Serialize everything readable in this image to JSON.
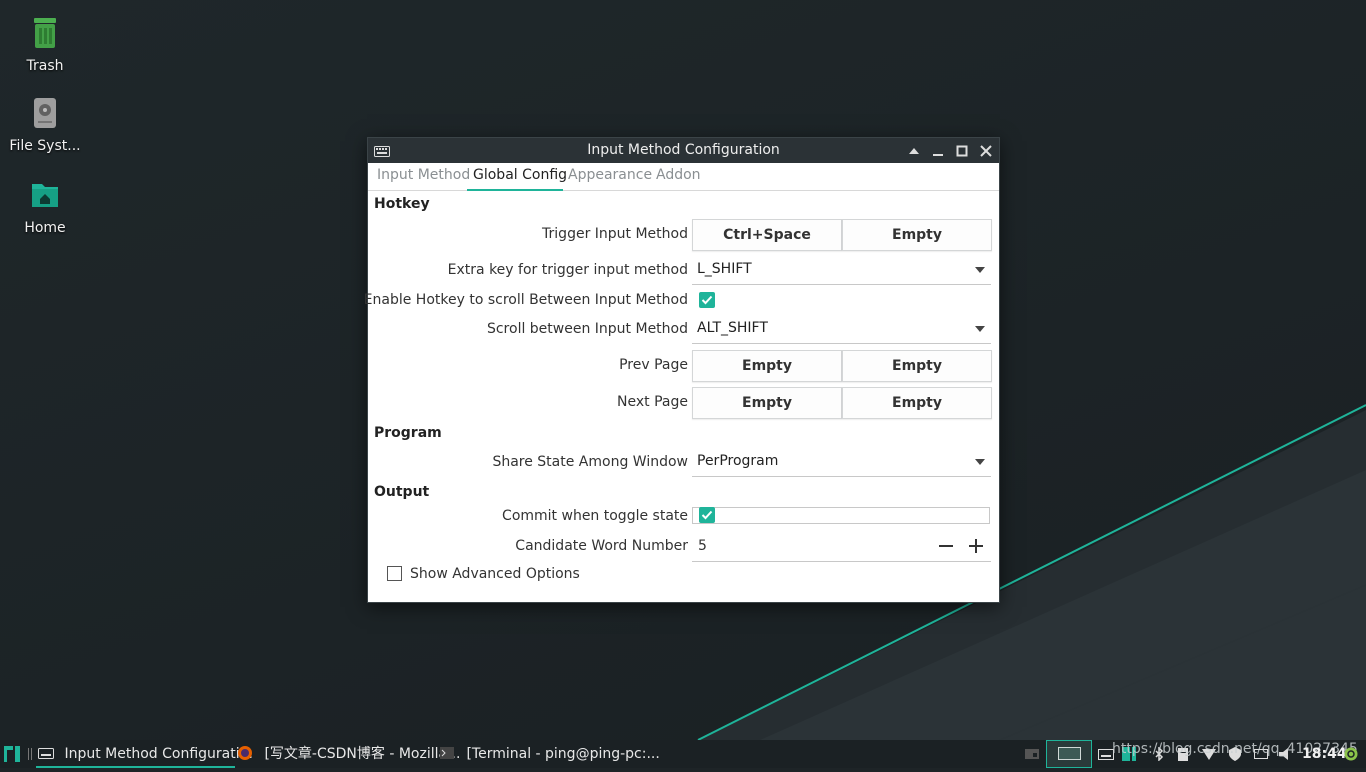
{
  "desktop": {
    "icons": [
      {
        "label": "Trash"
      },
      {
        "label": "File Syst..."
      },
      {
        "label": "Home"
      }
    ]
  },
  "window": {
    "title": "Input Method Configuration",
    "tabs": [
      {
        "label": "Input Method"
      },
      {
        "label": "Global Config"
      },
      {
        "label": "Appearance"
      },
      {
        "label": "Addon"
      }
    ],
    "active_tab": "Global Config",
    "sections": {
      "hotkey": "Hotkey",
      "program": "Program",
      "output": "Output"
    },
    "rows": {
      "trigger": {
        "label": "Trigger Input Method",
        "key1": "Ctrl+Space",
        "key2": "Empty"
      },
      "extra_key": {
        "label": "Extra key for trigger input method",
        "value": "L_SHIFT"
      },
      "enable_scroll": {
        "label": "Enable Hotkey to scroll Between Input Method",
        "checked": true
      },
      "scroll_between": {
        "label": "Scroll between Input Method",
        "value": "ALT_SHIFT"
      },
      "prev_page": {
        "label": "Prev Page",
        "key1": "Empty",
        "key2": "Empty"
      },
      "next_page": {
        "label": "Next Page",
        "key1": "Empty",
        "key2": "Empty"
      },
      "share_state": {
        "label": "Share State Among Window",
        "value": "PerProgram"
      },
      "commit_toggle": {
        "label": "Commit when toggle state",
        "checked": true
      },
      "candidate_number": {
        "label": "Candidate Word Number",
        "value": "5"
      }
    },
    "show_advanced": {
      "label": "Show Advanced Options",
      "checked": false
    }
  },
  "taskbar": {
    "tasks": [
      {
        "label": "Input Method Configurati..."
      },
      {
        "label": "[写文章-CSDN博客 - Mozilla..."
      },
      {
        "label": "[Terminal - ping@ping-pc:..."
      }
    ],
    "watermark": "https://blog.csdn.net/qq_41027345",
    "clock": "18:44"
  },
  "colors": {
    "accent": "#1fb49a",
    "titlebar": "#2b3236",
    "taskbar": "#1b2124",
    "desktop": "#1f272a"
  }
}
